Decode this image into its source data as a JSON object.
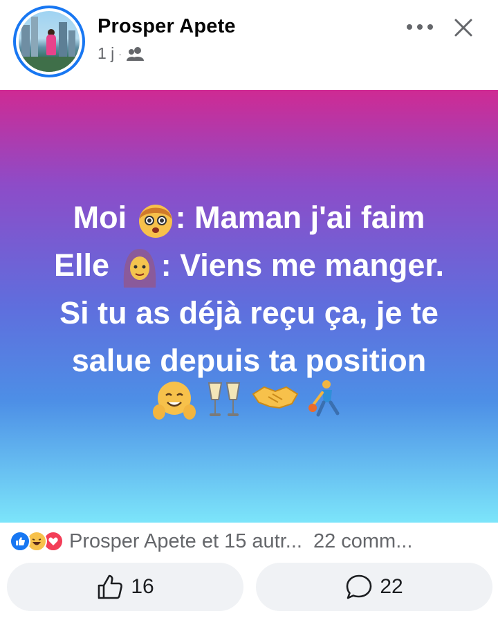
{
  "header": {
    "author_name": "Prosper Apete",
    "time_ago": "1 j",
    "separator": "·",
    "audience_icon": "friends-icon",
    "more_icon": "more-dots-icon",
    "close_icon": "close-icon"
  },
  "post": {
    "lines": [
      {
        "before": "Moi ",
        "emoji": "child-face",
        "after": ": Maman j'ai faim"
      },
      {
        "before": "Elle ",
        "emoji": "woman-headscarf",
        "after": ": Viens me manger."
      },
      {
        "text": "Si tu as déjà reçu ça, je te"
      },
      {
        "text": "salue depuis ta position"
      }
    ],
    "emoji_row": [
      "hugging-face",
      "clinking-glasses",
      "handshake",
      "person-bouncing-ball"
    ],
    "background_colors": [
      "#cf2a93",
      "#8d4cc8",
      "#5f6edd",
      "#4d8fe6",
      "#7ce5fa"
    ]
  },
  "reactions": {
    "icons": [
      "like-reaction-icon",
      "haha-reaction-icon",
      "love-reaction-icon"
    ],
    "summary": "Prosper Apete et 15 autr...",
    "comments": "22 comm..."
  },
  "actions": {
    "like_count": "16",
    "comment_count": "22"
  },
  "colors": {
    "accent": "#1877f2",
    "secondary_text": "#65676b",
    "button_bg": "#f0f2f5"
  }
}
